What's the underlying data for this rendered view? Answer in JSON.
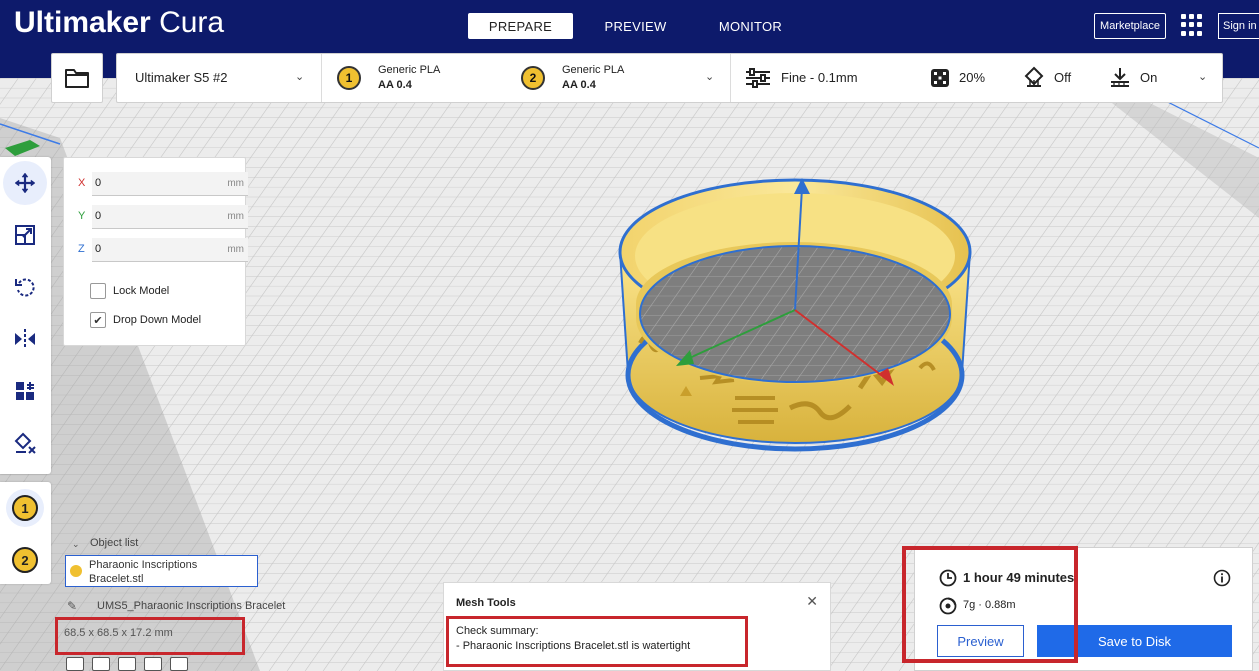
{
  "app": {
    "brand_bold": "Ultimaker",
    "brand_light": "Cura"
  },
  "stages": [
    "PREPARE",
    "PREVIEW",
    "MONITOR"
  ],
  "active_stage": "PREPARE",
  "header": {
    "marketplace_label": "Marketplace",
    "signin_label": "Sign in",
    "apps_icon": "apps-grid-icon"
  },
  "toolbar": {
    "open_icon": "folder-icon",
    "printer_name": "Ultimaker S5 #2",
    "extruder1": {
      "number": "1",
      "material": "Generic PLA",
      "core": "AA 0.4"
    },
    "extruder2": {
      "number": "2",
      "material": "Generic PLA",
      "core": "AA 0.4"
    },
    "profile_label": "Fine - 0.1mm",
    "infill_label": "20%",
    "support_label": "Off",
    "adhesion_label": "On"
  },
  "move_tool": {
    "x": {
      "label": "X",
      "value": "0",
      "unit": "mm"
    },
    "y": {
      "label": "Y",
      "value": "0",
      "unit": "mm"
    },
    "z": {
      "label": "Z",
      "value": "0",
      "unit": "mm"
    },
    "lock_label": "Lock Model",
    "lock_checked": false,
    "drop_label": "Drop Down Model",
    "drop_checked": true
  },
  "tools": [
    "move-icon",
    "scale-icon",
    "rotate-icon",
    "mirror-icon",
    "per-model-settings-icon",
    "support-blocker-icon"
  ],
  "extruder_buttons": [
    "1",
    "2"
  ],
  "object_list": {
    "label": "Object list",
    "item_name": "Pharaonic Inscriptions Bracelet.stl",
    "job_name": "UMS5_Pharaonic Inscriptions Bracelet",
    "dimensions": "68.5 x 68.5 x 17.2 mm"
  },
  "mesh_tools": {
    "title": "Mesh Tools",
    "summary_title": "Check summary:",
    "summary_line": "- Pharaonic Inscriptions Bracelet.stl is watertight"
  },
  "estimate": {
    "time": "1 hour 49 minutes",
    "material": "7g · 0.88m",
    "preview_label": "Preview",
    "save_label": "Save to Disk"
  },
  "colors": {
    "header": "#0d1a6b",
    "accent": "#1f6ae8",
    "model": "#f5dc6e",
    "highlight_box": "#c8262c"
  }
}
